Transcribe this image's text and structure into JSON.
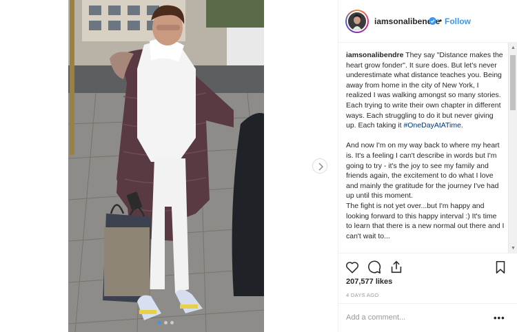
{
  "post": {
    "username": "iamsonalibendre",
    "follow_label": "Follow",
    "separator": "•",
    "verified_icon": "verified-badge-icon",
    "caption": {
      "username": "iamsonalibendre",
      "paragraph1_before_tag": " They say \"Distance makes the heart grow fonder\". It sure does. But let's never underestimate what distance teaches you. Being away from home in the city of New York, I realized I was walking amongst so many stories. Each trying to write their own chapter in different ways. Each struggling to do it but never giving up. Each taking it ",
      "hashtag": "#OneDayAtATime",
      "paragraph1_after_tag": ".",
      "paragraph2": "And now I'm on my way back to where my heart is. It's a feeling I can't describe in words but I'm going to try - it's the joy to see my family and friends again, the excitement to do what I love and mainly the gratitude for the journey I've had up until this moment.",
      "paragraph3": "The fight is not yet over...but I'm happy and looking forward to this happy interval :) It's time to learn that there is a new normal out there and I can't wait to..."
    },
    "likes": "207,577 likes",
    "time_ago": "4 DAYS AGO",
    "comment_placeholder": "Add a comment...",
    "more_label": "•••",
    "carousel": {
      "slides": 3,
      "active_index": 0
    },
    "colors": {
      "accent": "#3897f0",
      "hashtag": "#003569",
      "text": "#262626",
      "muted": "#999999"
    },
    "icons": [
      "heart-icon",
      "comment-icon",
      "share-icon",
      "bookmark-icon",
      "chevron-right-icon",
      "verified-badge-icon"
    ]
  }
}
